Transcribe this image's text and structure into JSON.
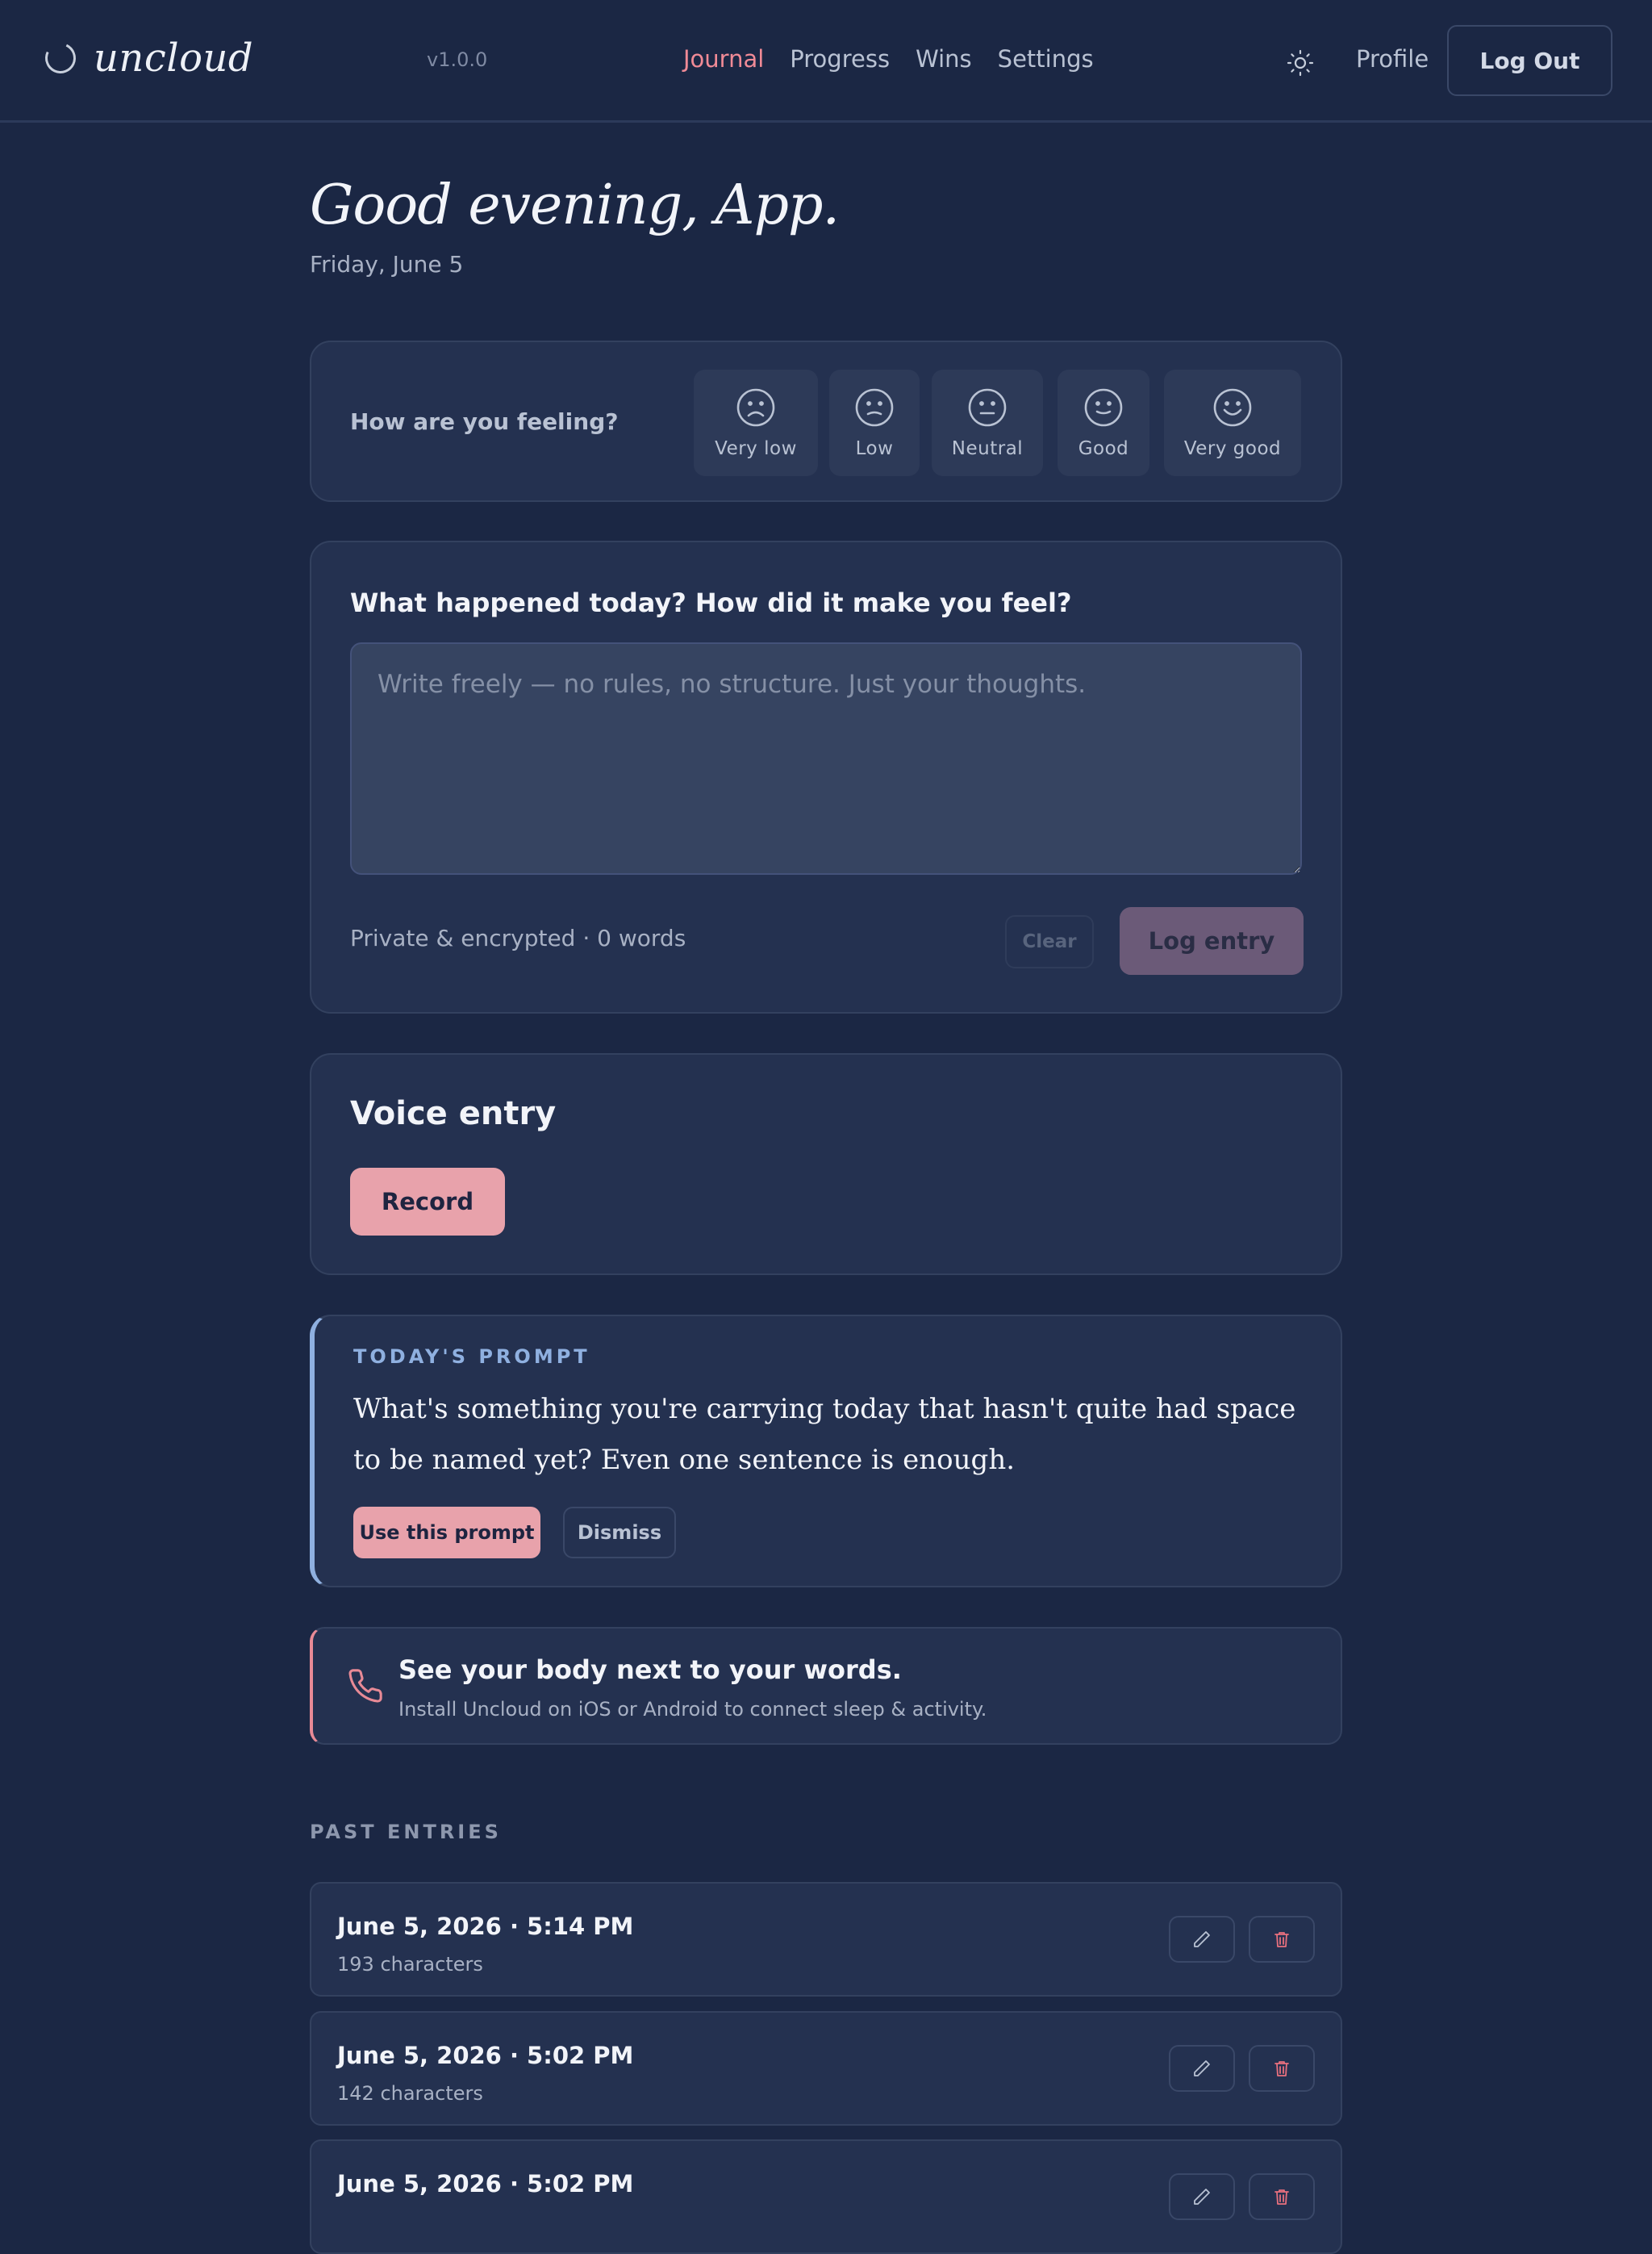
{
  "app": {
    "name": "uncloud",
    "version": "v1.0.0"
  },
  "nav": {
    "items": [
      {
        "label": "Journal",
        "active": true
      },
      {
        "label": "Progress",
        "active": false
      },
      {
        "label": "Wins",
        "active": false
      },
      {
        "label": "Settings",
        "active": false
      }
    ],
    "theme_icon": "sun-icon",
    "profile_label": "Profile",
    "logout_label": "Log Out"
  },
  "header": {
    "greeting": "Good evening, App.",
    "date": "Friday, June 5"
  },
  "mood": {
    "label": "How are you feeling?",
    "options": [
      {
        "label": "Very low",
        "icon": "very-low-face-icon"
      },
      {
        "label": "Low",
        "icon": "low-face-icon"
      },
      {
        "label": "Neutral",
        "icon": "neutral-face-icon"
      },
      {
        "label": "Good",
        "icon": "good-face-icon"
      },
      {
        "label": "Very good",
        "icon": "very-good-face-icon"
      }
    ]
  },
  "entry": {
    "title": "What happened today? How did it make you feel?",
    "placeholder": "Write freely — no rules, no structure. Just your thoughts.",
    "value": "",
    "meta": "Private & encrypted · 0 words",
    "clear_label": "Clear",
    "log_label": "Log entry"
  },
  "voice": {
    "title": "Voice entry",
    "record_label": "Record"
  },
  "prompt": {
    "eyebrow": "TODAY'S PROMPT",
    "text": "What's something you're carrying today that hasn't quite had space to be named yet? Even one sentence is enough.",
    "use_label": "Use this prompt",
    "dismiss_label": "Dismiss"
  },
  "health": {
    "icon": "phone-icon",
    "title": "See your body next to your words.",
    "subtitle": "Install Uncloud on iOS or Android to connect sleep & activity."
  },
  "past": {
    "heading": "PAST ENTRIES",
    "entries": [
      {
        "when": "June 5, 2026 · 5:14 PM",
        "chars": "193 characters"
      },
      {
        "when": "June 5, 2026 · 5:02 PM",
        "chars": "142 characters"
      },
      {
        "when": "June 5, 2026 · 5:02 PM",
        "chars": ""
      }
    ]
  },
  "colors": {
    "background": "#1b2744",
    "card": "#243150",
    "accent_pink": "#e8a2ab",
    "active_nav": "#f08a96",
    "prompt_accent": "#8fb0e0"
  }
}
